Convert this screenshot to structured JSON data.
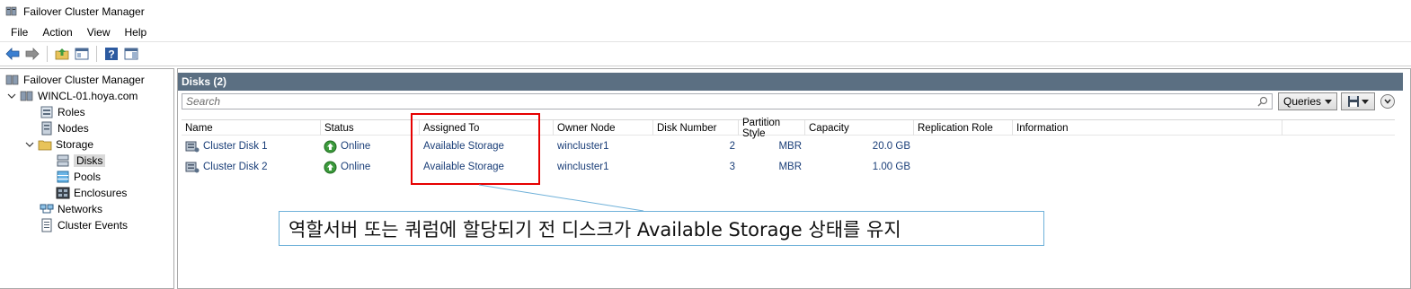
{
  "window": {
    "title": "Failover Cluster Manager"
  },
  "menu": [
    "File",
    "Action",
    "View",
    "Help"
  ],
  "toolbar": {
    "icons": [
      "back-icon",
      "forward-icon",
      "up-folder-icon",
      "show-hide-tree-icon",
      "help-icon",
      "action-pane-icon"
    ]
  },
  "tree": {
    "root": "Failover Cluster Manager",
    "cluster": "WINCL-01.hoya.com",
    "items": [
      "Roles",
      "Nodes",
      "Storage",
      "Disks",
      "Pools",
      "Enclosures",
      "Networks",
      "Cluster Events"
    ]
  },
  "panel": {
    "title": "Disks (2)",
    "search_placeholder": "Search",
    "queries_label": "Queries"
  },
  "columns": [
    "Name",
    "Status",
    "Assigned To",
    "Owner Node",
    "Disk Number",
    "Partition Style",
    "Capacity",
    "Replication Role",
    "Information"
  ],
  "rows": [
    {
      "name": "Cluster Disk 1",
      "status": "Online",
      "assigned_to": "Available Storage",
      "owner_node": "wincluster1",
      "disk_number": "2",
      "partition_style": "MBR",
      "capacity": "20.0 GB",
      "replication_role": "",
      "information": ""
    },
    {
      "name": "Cluster Disk 2",
      "status": "Online",
      "assigned_to": "Available Storage",
      "owner_node": "wincluster1",
      "disk_number": "3",
      "partition_style": "MBR",
      "capacity": "1.00 GB",
      "replication_role": "",
      "information": ""
    }
  ],
  "annotation": {
    "text": "역할서버 또는 쿼럼에 할당되기 전 디스크가 Available Storage 상태를 유지",
    "highlight_color": "#e60000",
    "callout_border": "#6fb1d9"
  },
  "colors": {
    "header_bar": "#5b6f82",
    "link_text": "#1a3e78",
    "status_online": "#3c9a3c"
  }
}
